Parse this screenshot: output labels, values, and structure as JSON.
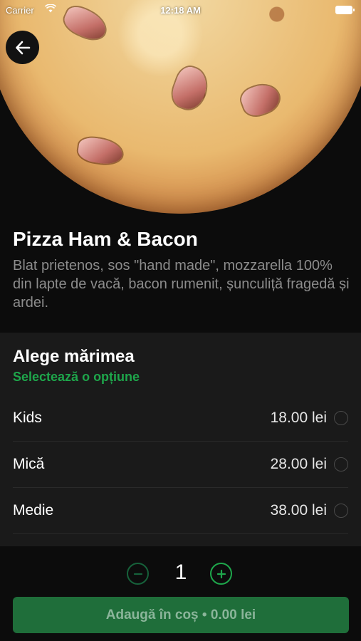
{
  "status_bar": {
    "carrier": "Carrier",
    "time": "12:18 AM"
  },
  "product": {
    "image": "pizza-ham-bacon-photo",
    "title": "Pizza Ham & Bacon",
    "description": "Blat prietenos, sos \"hand made\", mozzarella 100% din lapte de vacă, bacon rumenit, șunculiță fragedă și ardei."
  },
  "size_options": {
    "heading": "Alege mărimea",
    "subheading": "Selectează o opțiune",
    "items": [
      {
        "name": "Kids",
        "price": "18.00 lei",
        "selected": false
      },
      {
        "name": "Mică",
        "price": "28.00 lei",
        "selected": false
      },
      {
        "name": "Medie",
        "price": "38.00 lei",
        "selected": false
      }
    ]
  },
  "quantity": {
    "value": "1"
  },
  "cart_button": {
    "label": "Adaugă în coș • 0.00 lei"
  },
  "colors": {
    "accent": "#1ea64b",
    "button_bg": "#1f6e3a",
    "background": "#0c0c0c",
    "panel": "#1a1a1a"
  },
  "icons": {
    "back": "arrow-left-icon",
    "minus": "minus-circle-icon",
    "plus": "plus-circle-icon",
    "radio": "radio-unchecked-icon"
  }
}
